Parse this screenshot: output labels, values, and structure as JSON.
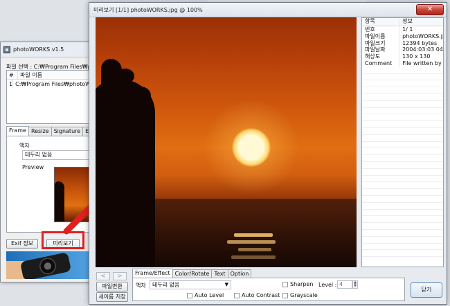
{
  "back_window": {
    "title": "photoWORKS v1.5",
    "path_label": "파일 선택 : C:₩Program Files₩photo",
    "list_headers": [
      "#",
      "파일 이름"
    ],
    "list_rows": [
      [
        "1",
        "C:₩Program Files₩photoWOR"
      ]
    ],
    "tabs": [
      "Frame",
      "Resize",
      "Signature",
      "Effe"
    ],
    "frame_label": "액자",
    "frame_value": "테두리 없음",
    "preview_label": "Preview",
    "exif_button": "Exif 정보",
    "preview_button": "미리보기"
  },
  "preview_window": {
    "title": "미리보기 [1/1] photoWORKS.jpg @ 100%",
    "close_symbol": "✕",
    "info_headers": [
      "항목",
      "정보"
    ],
    "info_rows": [
      [
        "번호",
        "1/ 1"
      ],
      [
        "파일이름",
        "photoWORKS.jpg"
      ],
      [
        "파일크기",
        "12394 bytes"
      ],
      [
        "파일날짜",
        "2004:03:03 04:05:58"
      ],
      [
        "해상도",
        "130 x 130"
      ],
      [
        "Comment",
        "File written by A..."
      ]
    ],
    "nav_prev": "<",
    "nav_next": ">",
    "convert_button": "파일변환",
    "save_as_button": "새이름 저장",
    "tabs": [
      "Frame/Effect",
      "Color/Rotate",
      "Text",
      "Option"
    ],
    "frame_label": "액자",
    "frame_value": "테두리 없음",
    "sharpen_label": "Sharpen",
    "level_label": "Level :",
    "level_value": "4",
    "auto_level_label": "Auto Level",
    "auto_contrast_label": "Auto Contrast",
    "grayscale_label": "Grayscale",
    "ok_button": "닫기"
  },
  "annotation": {
    "color": "#e02020"
  }
}
